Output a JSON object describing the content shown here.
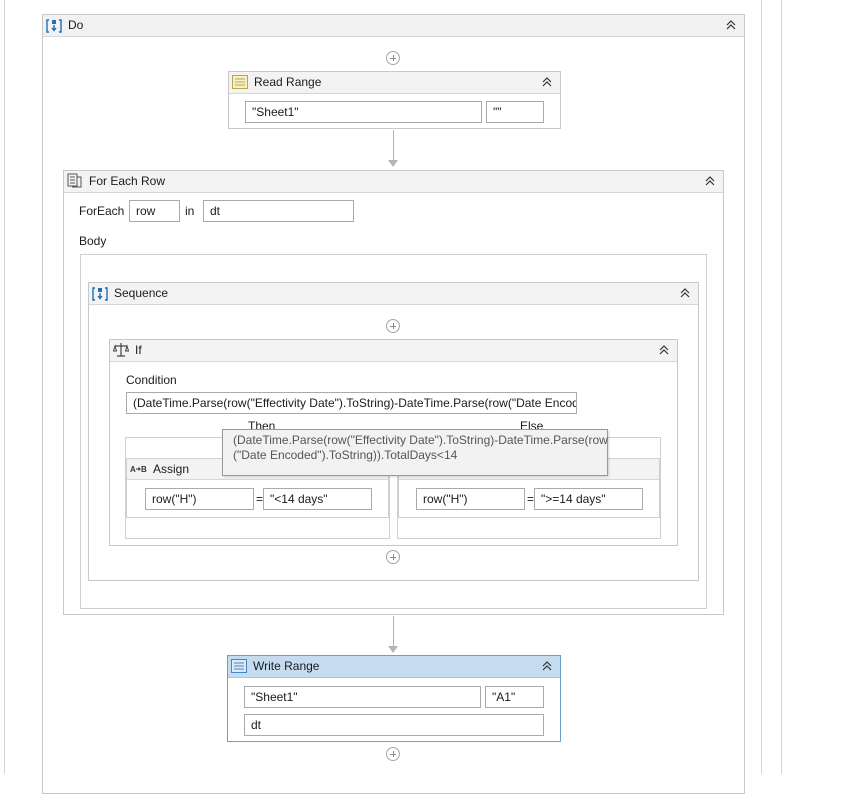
{
  "do": {
    "title": "Do"
  },
  "read_range": {
    "title": "Read Range",
    "sheet": "\"Sheet1\"",
    "range": "\"\""
  },
  "for_each": {
    "title": "For Each Row",
    "foreach_label": "ForEach",
    "item": "row",
    "in_label": "in",
    "collection": "dt",
    "body_label": "Body"
  },
  "sequence": {
    "title": "Sequence"
  },
  "if_activity": {
    "title": "If",
    "condition_label": "Condition",
    "condition": "(DateTime.Parse(row(\"Effectivity Date\").ToString)-DateTime.Parse(row(\"Date Encoded\").ToString)).TotalDays<14",
    "then_label": "Then",
    "else_label": "Else",
    "tooltip_line1": "(DateTime.Parse(row(\"Effectivity Date\").ToString)-DateTime.Parse(row",
    "tooltip_line2": "(\"Date Encoded\").ToString)).TotalDays<14"
  },
  "assign_then": {
    "title": "Assign",
    "to": "row(\"H\")",
    "eq": "=",
    "value": "\"<14 days\""
  },
  "assign_else": {
    "to": "row(\"H\")",
    "eq": "=",
    "value": "\">=14 days\""
  },
  "write_range": {
    "title": "Write Range",
    "sheet": "\"Sheet1\"",
    "range": "\"A1\"",
    "datatable": "dt"
  },
  "colors": {
    "selected_header": "#c5dcf0",
    "selected_border": "#6e9ccf",
    "icon_blue": "#1f6fb5"
  },
  "icons": [
    "sequence-icon",
    "read-range-icon",
    "for-each-row-icon",
    "if-icon",
    "assign-icon",
    "write-range-icon",
    "collapse-icon",
    "add-activity-icon"
  ]
}
